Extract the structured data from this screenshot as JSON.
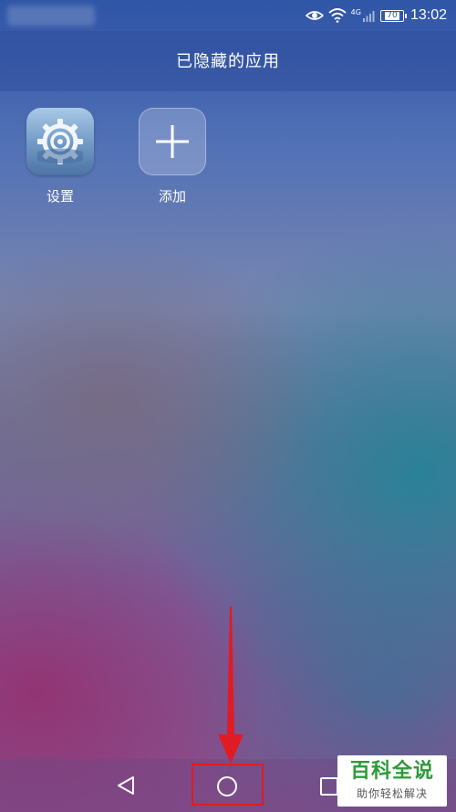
{
  "status_bar": {
    "network": "4G",
    "battery": "70",
    "time": "13:02"
  },
  "header": {
    "title": "已隐藏的应用"
  },
  "apps": [
    {
      "label": "设置",
      "icon": "settings-gear-icon"
    },
    {
      "label": "添加",
      "icon": "plus-icon"
    }
  ],
  "nav": {
    "back_icon": "back-triangle-icon",
    "home_icon": "home-circle-icon",
    "recent_icon": "recent-square-icon"
  },
  "annotation": {
    "color": "#e01b24"
  },
  "watermark": {
    "title": "百科全说",
    "subtitle": "助你轻松解决",
    "color": "#2e9a3a"
  }
}
